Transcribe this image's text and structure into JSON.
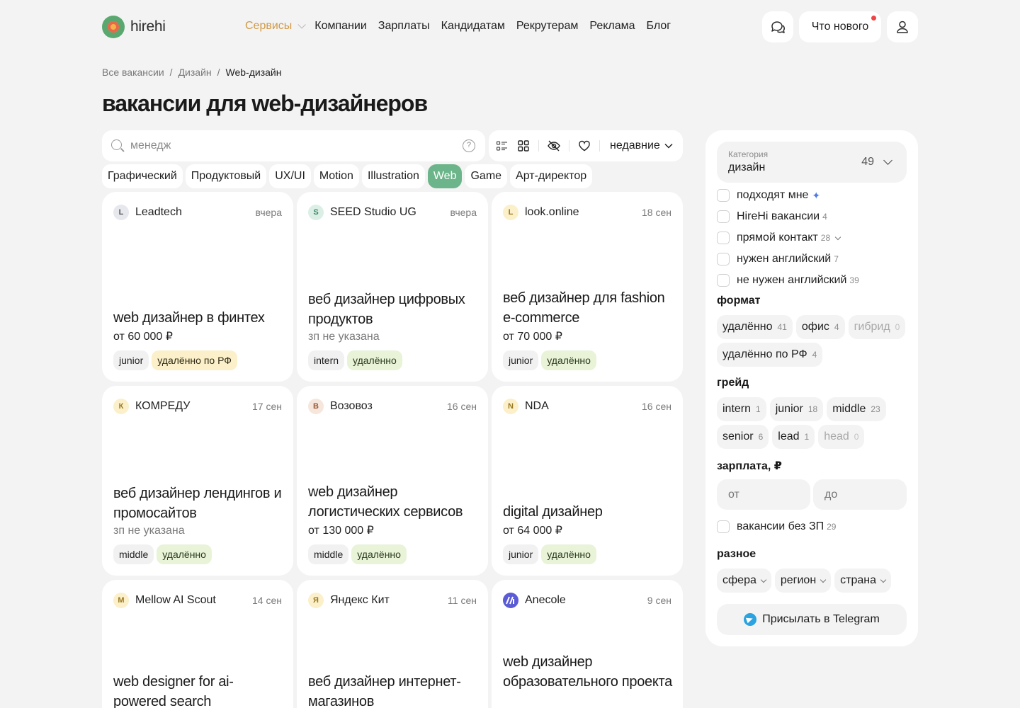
{
  "logo": {
    "text": "hirehi"
  },
  "nav": [
    {
      "label": "Сервисы"
    },
    {
      "label": "Компании"
    },
    {
      "label": "Зарплаты"
    },
    {
      "label": "Кандидатам"
    },
    {
      "label": "Рекрутерам"
    },
    {
      "label": "Реклама"
    },
    {
      "label": "Блог"
    }
  ],
  "header": {
    "news_label": "Что нового",
    "accent_color": "#d19a45"
  },
  "breadcrumb": [
    "Все вакансии",
    "Дизайн",
    "Web-дизайн"
  ],
  "breadcrumb_sep": "/",
  "page_title": "вакансии для web-дизайнеров",
  "search": {
    "value": "менедж",
    "help": "?"
  },
  "view": {
    "sort_label": "недавние"
  },
  "chips": [
    "Графический",
    "Продуктовый",
    "UX/UI",
    "Motion",
    "Illustration",
    "Web",
    "Game",
    "Арт-директор"
  ],
  "active_chip": "Web",
  "cards": [
    {
      "letter": "L",
      "company": "Leadtech",
      "date": "вчера",
      "title": "web дизайнер в финтех",
      "salary": "от 60 000 ₽",
      "grade": "junior",
      "format": "удалённо по РФ",
      "avatar_bg": "#e6e8ee",
      "avatar_fg": "#555",
      "tag_style": "yellow"
    },
    {
      "letter": "S",
      "company": "SEED Studio UG",
      "date": "вчера",
      "title": "веб дизайнер цифровых продуктов",
      "salary": "зп не указана",
      "grade": "intern",
      "format": "удалённо",
      "avatar_bg": "#dcefe6",
      "avatar_fg": "#3b8a63",
      "tag_style": "green"
    },
    {
      "letter": "L",
      "company": "look.online",
      "date": "18 сен",
      "title": "веб дизайнер для fashion e-commerce",
      "salary": "от 70 000 ₽",
      "grade": "junior",
      "format": "удалённо",
      "avatar_bg": "#fbf0c9",
      "avatar_fg": "#9a7a22",
      "tag_style": "green"
    },
    {
      "letter": "К",
      "company": "КОМРЕДУ",
      "date": "17 сен",
      "title": "веб дизайнер лендингов и промосайтов",
      "salary": "зп не указана",
      "grade": "middle",
      "format": "удалённо",
      "avatar_bg": "#fbf0c9",
      "avatar_fg": "#9a7a22",
      "tag_style": "green"
    },
    {
      "letter": "В",
      "company": "Возовоз",
      "date": "16 сен",
      "title": "web дизайнер логистических сервисов",
      "salary": "от 130 000 ₽",
      "grade": "middle",
      "format": "удалённо",
      "avatar_bg": "#f6e6dc",
      "avatar_fg": "#9a5a3a",
      "tag_style": "green"
    },
    {
      "letter": "N",
      "company": "NDA",
      "date": "16 сен",
      "title": "digital дизайнер",
      "salary": "от 64 000 ₽",
      "grade": "junior",
      "format": "удалённо",
      "avatar_bg": "#fbf0c9",
      "avatar_fg": "#9a7a22",
      "tag_style": "green"
    },
    {
      "letter": "M",
      "company": "Mellow AI Scout",
      "date": "14 сен",
      "title": "web designer for ai-powered search",
      "avatar_bg": "#fbf0c9",
      "avatar_fg": "#9a7a22"
    },
    {
      "letter": "Я",
      "company": "Яндекс Кит",
      "date": "11 сен",
      "title": "веб дизайнер интернет-магазинов",
      "avatar_bg": "#fbf0c9",
      "avatar_fg": "#9a7a22"
    },
    {
      "letter": "",
      "company": "Anecole",
      "date": "9 сен",
      "title": "web дизайнер образовательного проекта",
      "avatar_bg": "#5b5bd6",
      "avatar_fg": "#fff"
    }
  ],
  "sidebar": {
    "category_label": "Категория",
    "category_value": "дизайн",
    "category_count": "49",
    "checks": [
      {
        "label": "подходят мне",
        "count": "",
        "extra": "spark"
      },
      {
        "label": "HireHi вакансии",
        "count": "4"
      },
      {
        "label": "прямой контакт",
        "count": "28",
        "extra": "chev"
      },
      {
        "label": "нужен английский",
        "count": "7"
      },
      {
        "label": "не нужен английский",
        "count": "39"
      }
    ],
    "format_title": "формат",
    "format": [
      {
        "label": "удалённо",
        "count": "41"
      },
      {
        "label": "офис",
        "count": "4"
      },
      {
        "label": "гибрид",
        "count": "0",
        "dim": true
      },
      {
        "label": "удалённо по РФ",
        "count": "4"
      }
    ],
    "grade_title": "грейд",
    "grade": [
      {
        "label": "intern",
        "count": "1"
      },
      {
        "label": "junior",
        "count": "18"
      },
      {
        "label": "middle",
        "count": "23"
      },
      {
        "label": "senior",
        "count": "6"
      },
      {
        "label": "lead",
        "count": "1"
      },
      {
        "label": "head",
        "count": "0",
        "dim": true
      }
    ],
    "salary_title": "зарплата, ₽",
    "salary_from": "от",
    "salary_to": "до",
    "no_salary_label": "вакансии без ЗП",
    "no_salary_count": "29",
    "misc_title": "разное",
    "misc": [
      "сфера",
      "регион",
      "страна"
    ],
    "telegram_label": "Присылать в Telegram"
  }
}
